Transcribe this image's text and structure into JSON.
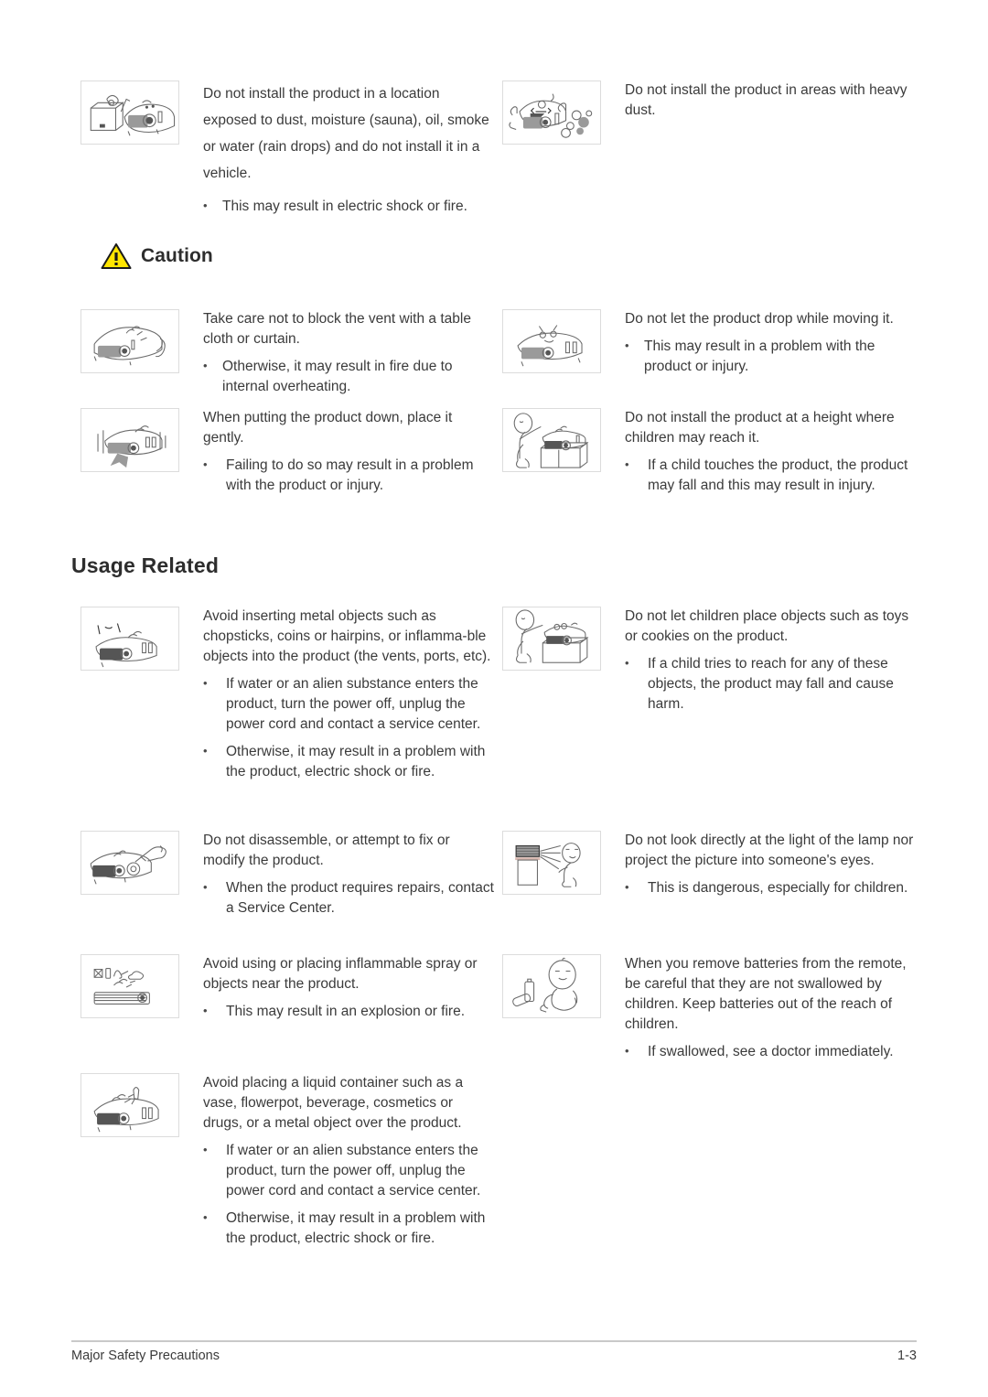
{
  "page": {
    "footer_left": "Major Safety Precautions",
    "footer_page": "1-3"
  },
  "headings": {
    "caution": "Caution",
    "caution_icon": "warning-triangle-icon",
    "usage_related": "Usage Related"
  },
  "colors": {
    "caution_triangle_fill": "#FFE500",
    "caution_triangle_stroke": "#1a1a1a",
    "text": "#3b3b3b",
    "heading": "#2d2d2d",
    "thumb_border": "#dcdcdc",
    "footer_rule": "#c9c9c9"
  },
  "blocks": {
    "install_location": {
      "icon": "projector-dust-moisture-icon",
      "text": "Do not install the product in a location exposed to dust, moisture (sauna), oil, smoke or water (rain drops) and do not install it in a vehicle.",
      "bullets": [
        "This may result in electric shock or fire."
      ]
    },
    "heavy_dust": {
      "icon": "projector-heavy-dust-icon",
      "text": "Do not install the product in areas with heavy dust.",
      "bullets": []
    },
    "block_vent": {
      "icon": "projector-covered-cloth-icon",
      "text": "Take care not to block the vent with a table cloth or curtain.",
      "bullets": [
        "Otherwise, it may result in fire due to internal overheating."
      ]
    },
    "drop_moving": {
      "icon": "projector-drop-icon",
      "text": "Do not let the product drop while moving it.",
      "bullets": [
        "This may result in a problem with the product or injury."
      ]
    },
    "put_down_gently": {
      "icon": "projector-place-gently-icon",
      "text": "When putting the product down, place it gently.",
      "bullets": [
        "Failing to do so may result in a problem with the product or injury."
      ]
    },
    "height_children": {
      "icon": "child-reaching-projector-icon",
      "text": "Do not install the product at a height where children may reach it.",
      "bullets": [
        "If a child touches the product, the product may fall and this may result in injury."
      ]
    },
    "metal_objects": {
      "icon": "metal-objects-into-projector-icon",
      "text": "Avoid inserting metal objects such as chopsticks, coins or hairpins, or inflamma-ble objects into the product (the vents, ports, etc).",
      "bullets": [
        "If water or an alien substance enters the product, turn the power off, unplug the power cord and contact a service center.",
        "Otherwise, it may result in a problem with the product, electric shock or fire."
      ]
    },
    "children_objects": {
      "icon": "child-placing-objects-icon",
      "text": "Do not let children place objects such as toys or cookies on the product.",
      "bullets": [
        "If a child tries to reach for any of these objects, the product may fall and cause harm."
      ]
    },
    "disassemble": {
      "icon": "projector-disassemble-icon",
      "text": "Do not disassemble, or attempt to fix or modify the product.",
      "bullets": [
        "When the product requires repairs, contact a Service Center."
      ]
    },
    "lamp_light": {
      "icon": "lamp-light-into-eyes-icon",
      "text": "Do not look directly at the light of the lamp nor project the picture into someone's eyes.",
      "bullets": [
        "This is dangerous, especially for children."
      ]
    },
    "inflammable_spray": {
      "icon": "inflammable-spray-icon",
      "text": "Avoid using or placing inflammable spray or objects near the product.",
      "bullets": [
        "This may result in an explosion or fire."
      ]
    },
    "batteries": {
      "icon": "child-swallowing-battery-icon",
      "text": "When you remove batteries from the remote, be careful that they are not swallowed by children. Keep batteries out of the reach of children.",
      "bullets": [
        "If swallowed, see a doctor immediately."
      ]
    },
    "liquid_container": {
      "icon": "liquid-container-on-projector-icon",
      "text": "Avoid placing a liquid container such as a vase, flowerpot, beverage, cosmetics or drugs, or a metal object over the product.",
      "bullets": [
        "If water or an alien substance enters the product, turn the power off, unplug the power cord and contact a service center.",
        "Otherwise, it may result in a problem with the product, electric shock or fire."
      ]
    }
  }
}
